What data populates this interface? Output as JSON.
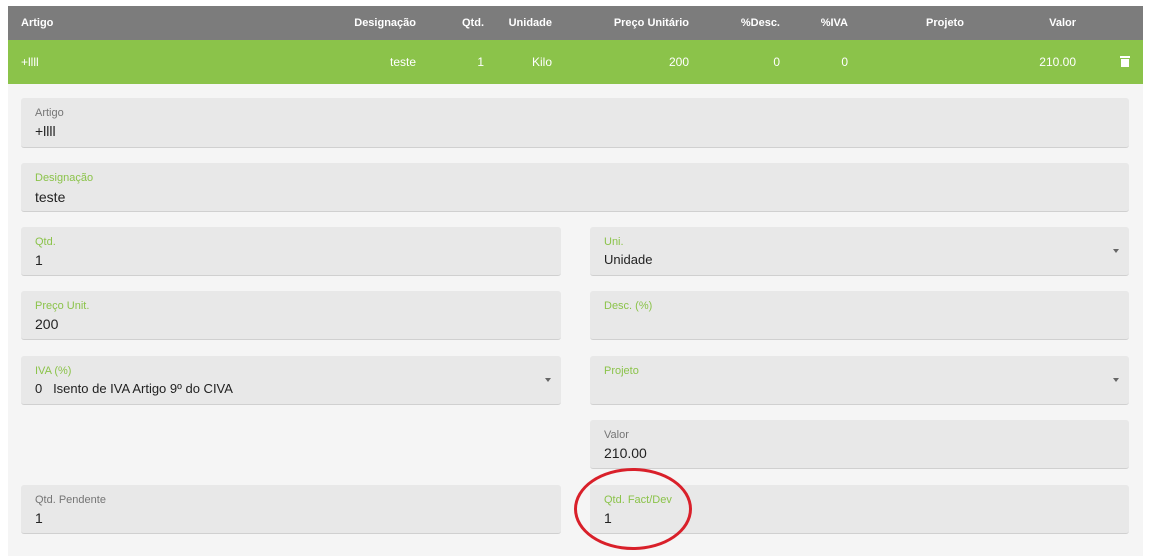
{
  "table": {
    "headers": {
      "artigo": "Artigo",
      "designacao": "Designação",
      "qtd": "Qtd.",
      "unidade": "Unidade",
      "preco": "Preço Unitário",
      "desc": "%Desc.",
      "iva": "%IVA",
      "projeto": "Projeto",
      "valor": "Valor"
    },
    "row": {
      "artigo": "+llll",
      "designacao": "teste",
      "qtd": "1",
      "unidade": "Kilo",
      "preco": "200",
      "desc": "0",
      "iva": "0",
      "projeto": "",
      "valor": "210.00"
    }
  },
  "form": {
    "artigo": {
      "label": "Artigo",
      "value": "+llll"
    },
    "designacao": {
      "label": "Designação",
      "value": "teste"
    },
    "qtd": {
      "label": "Qtd.",
      "value": "1"
    },
    "uni": {
      "label": "Uni.",
      "value": "Unidade"
    },
    "preco_unit": {
      "label": "Preço Unit.",
      "value": "200"
    },
    "desc": {
      "label": "Desc. (%)",
      "value": ""
    },
    "iva": {
      "label": "IVA (%)",
      "value": "0   Isento de IVA Artigo 9º do CIVA"
    },
    "projeto": {
      "label": "Projeto",
      "value": ""
    },
    "valor": {
      "label": "Valor",
      "value": "210.00"
    },
    "qtd_pendente": {
      "label": "Qtd. Pendente",
      "value": "1"
    },
    "qtd_fact_dev": {
      "label": "Qtd. Fact/Dev",
      "value": "1"
    }
  },
  "colors": {
    "accent": "#8bc34a",
    "header": "#7c7c7c",
    "annotation": "#d9202a"
  },
  "icons": {
    "delete": "trash-icon",
    "dropdown": "caret-down-icon"
  }
}
